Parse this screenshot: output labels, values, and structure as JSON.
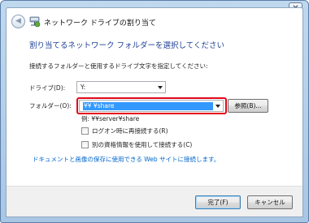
{
  "window": {
    "title": "ネットワーク ドライブの割り当て",
    "close_glyph": "✕",
    "back_glyph": "◀"
  },
  "main": {
    "heading": "割り当てるネットワーク フォルダーを選択してください",
    "instruction": "接続するフォルダーと使用するドライブ文字を指定してください:",
    "drive_label": "ドライブ(D):",
    "drive_value": "Y:",
    "folder_label": "フォルダー(O):",
    "folder_value": "¥¥              ¥share",
    "browse_label": "参照(B)...",
    "example": "例: ¥¥server¥share",
    "reconnect_label": "ログオン時に再接続する(R)",
    "reconnect_checked": false,
    "credentials_label": "別の資格情報を使用して接続する(C)",
    "credentials_checked": false,
    "link_text": "ドキュメントと画像の保存に使用できる Web サイトに接続します。"
  },
  "footer": {
    "finish_label": "完了(F)",
    "cancel_label": "キャンセル"
  },
  "colors": {
    "accent": "#1c3f94",
    "link": "#0066cc",
    "highlight": "#e2081a",
    "selection": "#3399ff"
  }
}
